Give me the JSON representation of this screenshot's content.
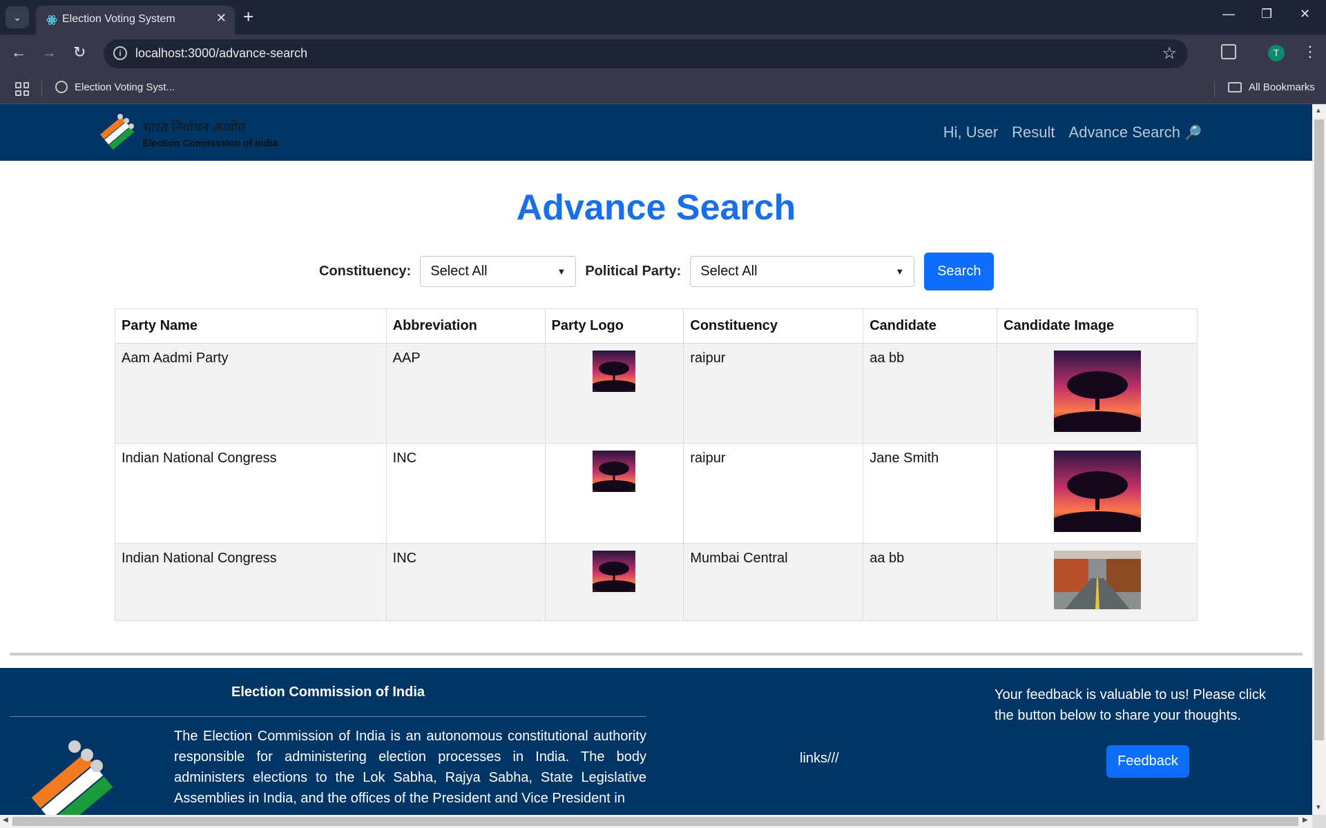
{
  "browser": {
    "tab_title": "Election Voting System",
    "url": "localhost:3000/advance-search",
    "bookmark_item": "Election Voting Syst...",
    "all_bookmarks": "All Bookmarks",
    "profile_initial": "T"
  },
  "header": {
    "logo_hindi": "भारत निर्वाचन आयोग",
    "logo_english": "Election Commission of India",
    "nav": {
      "greeting": "Hi, User",
      "result": "Result",
      "advance_search": "Advance Search",
      "advance_search_icon": "🔎"
    }
  },
  "main": {
    "title": "Advance Search",
    "filters": {
      "constituency_label": "Constituency:",
      "constituency_value": "Select All",
      "party_label": "Political Party:",
      "party_value": "Select All",
      "search_button": "Search"
    },
    "table": {
      "headers": [
        "Party Name",
        "Abbreviation",
        "Party Logo",
        "Constituency",
        "Candidate",
        "Candidate Image"
      ],
      "rows": [
        {
          "party": "Aam Aadmi Party",
          "abbr": "AAP",
          "constituency": "raipur",
          "candidate": "aa bb",
          "logo_image": "tree-sunset-image",
          "candidate_image": "tree-sunset-image"
        },
        {
          "party": "Indian National Congress",
          "abbr": "INC",
          "constituency": "raipur",
          "candidate": "Jane Smith",
          "logo_image": "tree-sunset-image",
          "candidate_image": "tree-sunset-image"
        },
        {
          "party": "Indian National Congress",
          "abbr": "INC",
          "constituency": "Mumbai Central",
          "candidate": "aa bb",
          "logo_image": "tree-sunset-image",
          "candidate_image": "autumn-road-image"
        }
      ]
    }
  },
  "footer": {
    "title": "Election Commission of India",
    "about": "The Election Commission of India is an autonomous constitutional authority responsible for administering election processes in India. The body administers elections to the Lok Sabha, Rajya Sabha, State Legislative Assemblies in India, and the offices of the President and Vice President in",
    "links": "links///",
    "feedback_text": "Your feedback is valuable to us! Please click the button below to share your thoughts.",
    "feedback_button": "Feedback"
  },
  "colors": {
    "header_bg": "#003566",
    "primary": "#0d6efd",
    "title": "#1a6fe8"
  }
}
